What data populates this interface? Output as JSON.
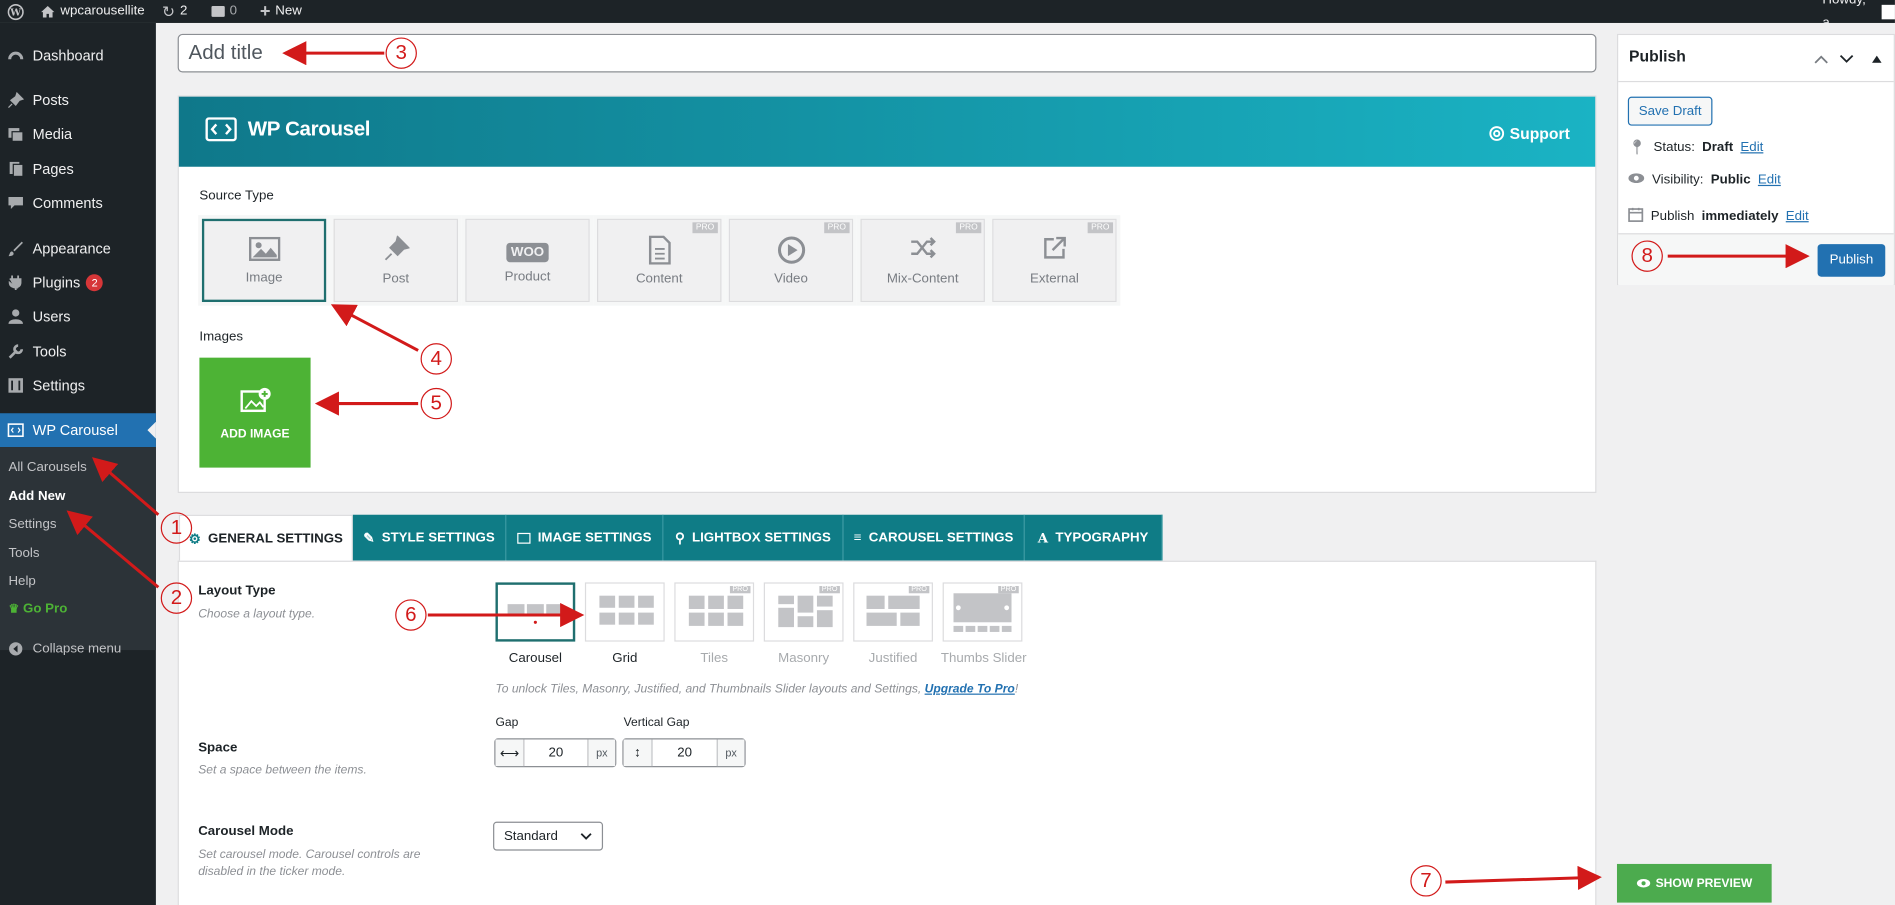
{
  "adminbar": {
    "site": "wpcarousellite",
    "updates": "2",
    "comments": "0",
    "new": "New",
    "howdy": "Howdy, a"
  },
  "sidebar": {
    "items": [
      {
        "label": "Dashboard"
      },
      {
        "label": "Posts"
      },
      {
        "label": "Media"
      },
      {
        "label": "Pages"
      },
      {
        "label": "Comments"
      },
      {
        "label": "Appearance"
      },
      {
        "label": "Plugins",
        "badge": "2"
      },
      {
        "label": "Users"
      },
      {
        "label": "Tools"
      },
      {
        "label": "Settings"
      },
      {
        "label": "WP Carousel"
      }
    ],
    "submenu": [
      "All Carousels",
      "Add New",
      "Settings",
      "Tools",
      "Help",
      "Go Pro"
    ],
    "collapse": "Collapse menu"
  },
  "title_placeholder": "Add title",
  "wpc": {
    "brand": "WP Carousel",
    "support": "Support",
    "source_type_label": "Source Type",
    "sources": [
      {
        "label": "Image"
      },
      {
        "label": "Post"
      },
      {
        "label": "Product",
        "icon_text": "WOO"
      },
      {
        "label": "Content",
        "pro": "PRO"
      },
      {
        "label": "Video",
        "pro": "PRO"
      },
      {
        "label": "Mix-Content",
        "pro": "PRO"
      },
      {
        "label": "External",
        "pro": "PRO"
      }
    ],
    "images_label": "Images",
    "add_image": "ADD IMAGE"
  },
  "tabs": [
    "GENERAL SETTINGS",
    "STYLE SETTINGS",
    "IMAGE SETTINGS",
    "LIGHTBOX SETTINGS",
    "CAROUSEL SETTINGS",
    "TYPOGRAPHY"
  ],
  "settings": {
    "layout_type": {
      "title": "Layout Type",
      "desc": "Choose a layout type."
    },
    "layouts": [
      {
        "label": "Carousel"
      },
      {
        "label": "Grid"
      },
      {
        "label": "Tiles",
        "pro": "PRO"
      },
      {
        "label": "Masonry",
        "pro": "PRO"
      },
      {
        "label": "Justified",
        "pro": "PRO"
      },
      {
        "label": "Thumbs Slider",
        "pro": "PRO"
      }
    ],
    "unlock_text": "To unlock Tiles, Masonry, Justified, and Thumbnails Slider layouts and Settings, ",
    "upgrade_link": "Upgrade To Pro",
    "unlock_end": "!",
    "space": {
      "title": "Space",
      "desc": "Set a space between the items."
    },
    "gap": {
      "label": "Gap",
      "value": "20",
      "unit": "px"
    },
    "vgap": {
      "label": "Vertical Gap",
      "value": "20",
      "unit": "px"
    },
    "carousel_mode": {
      "title": "Carousel Mode",
      "desc1": "Set carousel mode. Carousel controls are",
      "desc2": "disabled in the ticker mode.",
      "value": "Standard"
    }
  },
  "publish": {
    "title": "Publish",
    "save_draft": "Save Draft",
    "status_label": "Status:",
    "status_value": "Draft",
    "visibility_label": "Visibility:",
    "visibility_value": "Public",
    "publish_label": "Publish",
    "publish_value": "immediately",
    "edit": "Edit",
    "button": "Publish"
  },
  "show_preview": "SHOW PREVIEW",
  "annotations": [
    "1",
    "2",
    "3",
    "4",
    "5",
    "6",
    "7",
    "8"
  ],
  "colors": {
    "accent": "#2271b1",
    "brand_teal": "#0f7c86",
    "add_green": "#4db335",
    "preview_green": "#4cab4e",
    "annotation_red": "#d21a1a"
  }
}
